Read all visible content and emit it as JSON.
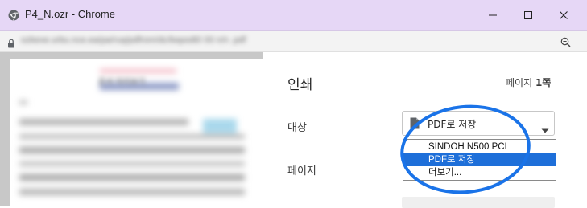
{
  "window": {
    "title": "P4_N.ozr - Chrome",
    "browser_icon": "chrome-icon",
    "controls": {
      "minimize_icon": "minimize-icon",
      "maximize_icon": "maximize-icon",
      "close_icon": "close-icon"
    },
    "titlebar_color": "#e6d7f6"
  },
  "address_bar": {
    "lock_icon": "lock-icon",
    "url_obscured": "ozkexe.urbu.nce.ea/pa/ruq/pdfrom/dc/kepodt0 00 n/n .pdf",
    "zoom_icon": "zoom-icon"
  },
  "print_dialog": {
    "title": "인쇄",
    "page_count_prefix": "페이지 ",
    "page_count_value": "1쪽",
    "destination_label": "대상",
    "destination_selected": "PDF로 저장",
    "destination_icon": "document-icon",
    "pages_label": "페이지",
    "destination_options": [
      "SINDOH N500 PCL",
      "PDF로 저장",
      "더보기..."
    ],
    "highlighted_option_index": 1,
    "highlight_color": "#1e6fd9"
  },
  "annotation": {
    "shape": "ellipse",
    "color": "#1a73e8"
  },
  "preview": {
    "obscured_text": "문서 미리보기"
  }
}
